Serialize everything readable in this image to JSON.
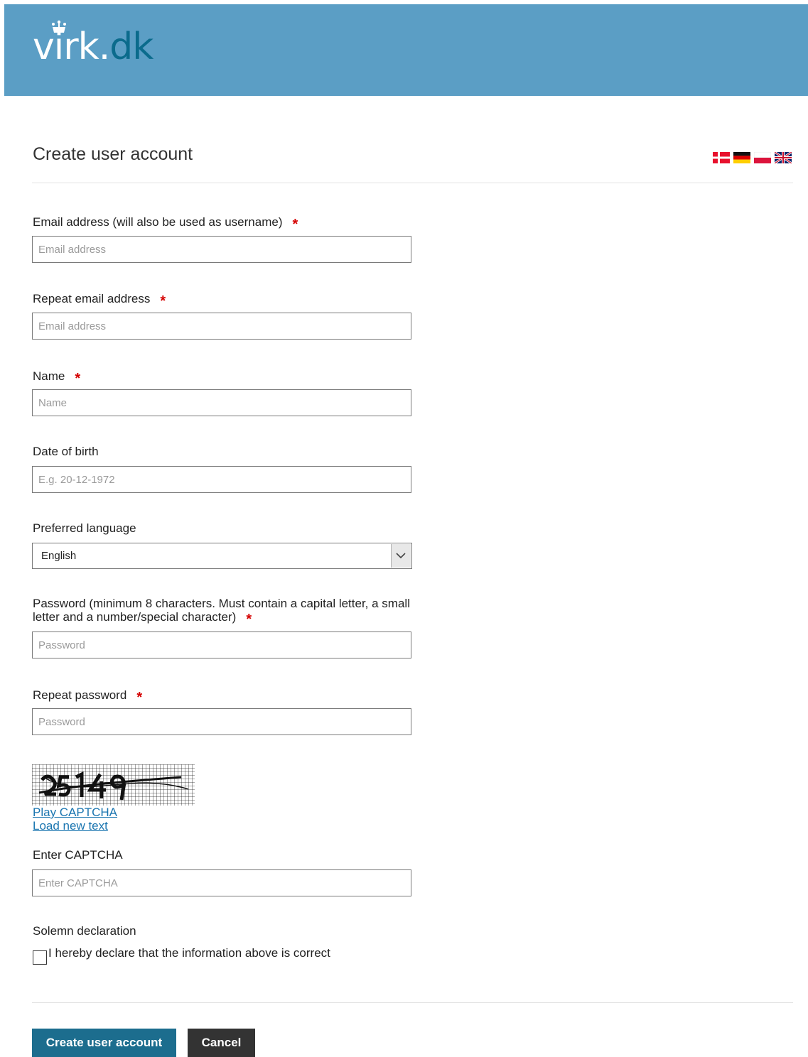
{
  "header": {
    "logo_main": "virk",
    "logo_dot": ".",
    "logo_tld": "dk"
  },
  "page": {
    "title": "Create user account"
  },
  "languages": [
    {
      "name": "Danish flag",
      "icon": "flag-dk-icon"
    },
    {
      "name": "German flag",
      "icon": "flag-de-icon"
    },
    {
      "name": "Polish flag",
      "icon": "flag-pl-icon"
    },
    {
      "name": "UK flag",
      "icon": "flag-gb-icon"
    }
  ],
  "form": {
    "email": {
      "label": "Email address (will also be used as username)",
      "placeholder": "Email address",
      "required_mark": "*"
    },
    "repeat_email": {
      "label": "Repeat email address",
      "placeholder": "Email address",
      "required_mark": "*"
    },
    "name": {
      "label": "Name",
      "placeholder": "Name",
      "required_mark": "*"
    },
    "dob": {
      "label": "Date of birth",
      "placeholder": "E.g. 20-12-1972"
    },
    "language": {
      "label": "Preferred language",
      "value": "English"
    },
    "password": {
      "label_line1": "Password (minimum 8 characters. Must contain a capital letter, a small",
      "label_line2": "letter and a number/special character)",
      "placeholder": "Password",
      "required_mark": "*"
    },
    "repeat_password": {
      "label": "Repeat password",
      "placeholder": "Password",
      "required_mark": "*"
    },
    "captcha": {
      "play_link": "Play CAPTCHA",
      "reload_link": "Load new text",
      "label": "Enter CAPTCHA",
      "placeholder": "Enter CAPTCHA"
    },
    "declaration": {
      "heading": "Solemn declaration",
      "checkbox_label": "I hereby declare that the information above is correct",
      "checked": false
    }
  },
  "actions": {
    "submit_label": "Create user account",
    "cancel_label": "Cancel"
  },
  "colors": {
    "header_bg": "#5b9ec5",
    "primary_button": "#1c6d8e",
    "cancel_button": "#333333",
    "required": "#d50000",
    "link": "#1a75b0"
  }
}
